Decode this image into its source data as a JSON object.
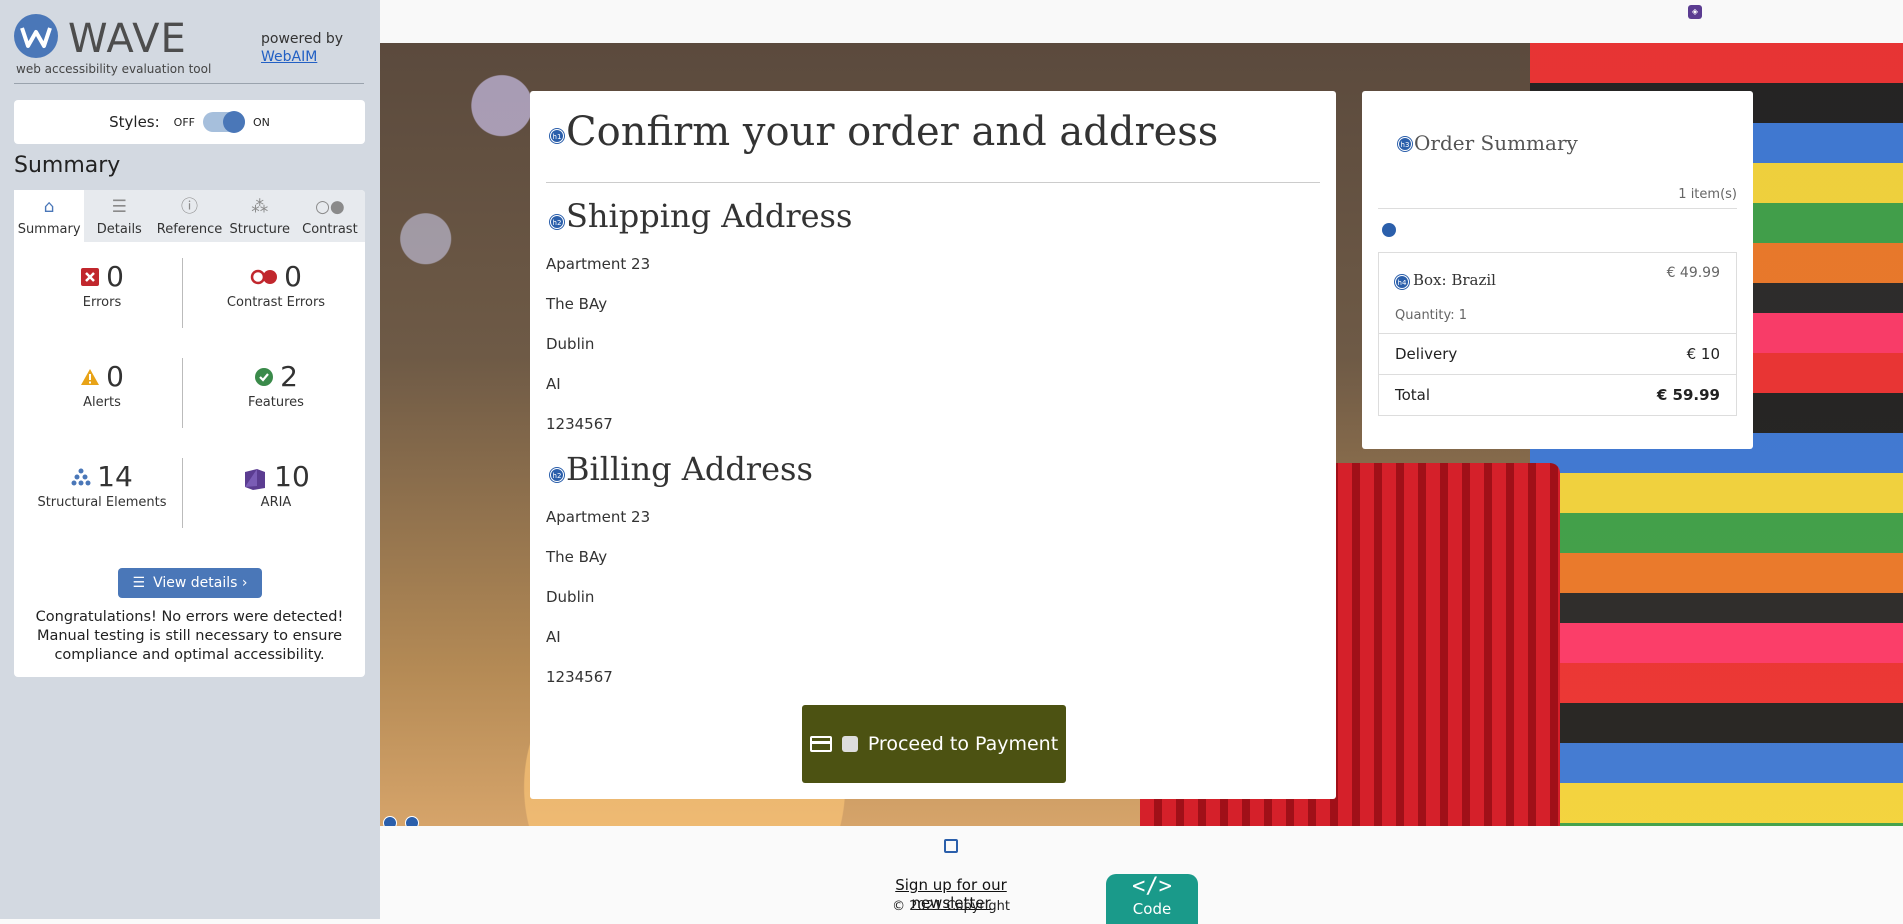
{
  "wave": {
    "title": "WAVE",
    "tagline": "web accessibility evaluation tool",
    "powered_by": "powered by",
    "webaim": "WebAIM",
    "styles_label": "Styles:",
    "styles_off": "OFF",
    "styles_on": "ON",
    "summary_heading": "Summary",
    "tabs": [
      {
        "label": "Summary",
        "icon": "home-icon"
      },
      {
        "label": "Details",
        "icon": "list-icon"
      },
      {
        "label": "Reference",
        "icon": "info-icon"
      },
      {
        "label": "Structure",
        "icon": "structure-icon"
      },
      {
        "label": "Contrast",
        "icon": "contrast-icon"
      }
    ],
    "stats": {
      "errors": {
        "value": "0",
        "label": "Errors"
      },
      "contrast_errors": {
        "value": "0",
        "label": "Contrast Errors"
      },
      "alerts": {
        "value": "0",
        "label": "Alerts"
      },
      "features": {
        "value": "2",
        "label": "Features"
      },
      "structural": {
        "value": "14",
        "label": "Structural Elements"
      },
      "aria": {
        "value": "10",
        "label": "ARIA"
      }
    },
    "view_details": "View details ›",
    "congrats": "Congratulations! No errors were detected! Manual testing is still necessary to ensure compliance and optimal accessibility."
  },
  "order": {
    "title": "Confirm your order and address",
    "shipping_heading": "Shipping Address",
    "shipping": [
      "Apartment 23",
      "The BAy",
      "Dublin",
      "AI",
      "1234567"
    ],
    "billing_heading": "Billing Address",
    "billing": [
      "Apartment 23",
      "The BAy",
      "Dublin",
      "AI",
      "1234567"
    ],
    "pay_button": "Proceed to Payment"
  },
  "summary": {
    "title": "Order Summary",
    "items_count": "1 item(s)",
    "item_name": "Box: Brazil",
    "item_price": "€ 49.99",
    "item_qty": "Quantity: 1",
    "delivery_label": "Delivery",
    "delivery_value": "€ 10",
    "total_label": "Total",
    "total_value": "€ 59.99"
  },
  "footer": {
    "newsletter": "Sign up for our newsletter",
    "copyright": "© 2021 Copyright",
    "code_symbol": "</>",
    "code_label": "Code"
  },
  "colors": {
    "wave_blue": "#4a77b8",
    "pay_button": "#4c5212",
    "code_button": "#1a9a8a"
  }
}
